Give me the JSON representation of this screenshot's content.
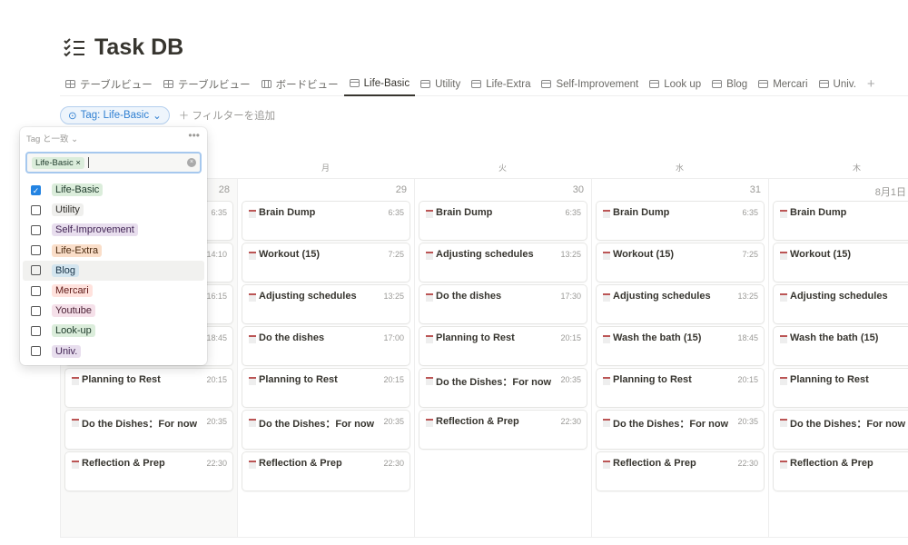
{
  "page": {
    "title": "Task DB",
    "icon": "checklist-icon"
  },
  "tabs": [
    {
      "label": "テーブルビュー",
      "icon": "table-icon"
    },
    {
      "label": "テーブルビュー",
      "icon": "table-icon"
    },
    {
      "label": "ボードビュー",
      "icon": "board-icon"
    },
    {
      "label": "Life-Basic",
      "icon": "calendar-icon",
      "active": true
    },
    {
      "label": "Utility",
      "icon": "calendar-icon"
    },
    {
      "label": "Life-Extra",
      "icon": "calendar-icon"
    },
    {
      "label": "Self-Improvement",
      "icon": "calendar-icon"
    },
    {
      "label": "Look up",
      "icon": "calendar-icon"
    },
    {
      "label": "Blog",
      "icon": "calendar-icon"
    },
    {
      "label": "Mercari",
      "icon": "calendar-icon"
    },
    {
      "label": "Univ.",
      "icon": "calendar-icon"
    }
  ],
  "add_tab": "+",
  "filter": {
    "chip": "Tag: Life-Basic",
    "add": "＋ フィルターを追加"
  },
  "popup": {
    "header": "Tag と一致 ⌄",
    "more": "•••",
    "selected_tag": "Life-Basic",
    "remove": "×",
    "options": [
      {
        "label": "Life-Basic",
        "checked": true,
        "bg": "#dbeddb",
        "fg": "#1c3829"
      },
      {
        "label": "Utility",
        "checked": false,
        "bg": "#efefed",
        "fg": "#32302c"
      },
      {
        "label": "Self-Improvement",
        "checked": false,
        "bg": "#e8deee",
        "fg": "#412454"
      },
      {
        "label": "Life-Extra",
        "checked": false,
        "bg": "#fadec9",
        "fg": "#49290e"
      },
      {
        "label": "Blog",
        "checked": false,
        "bg": "#d3e5ef",
        "fg": "#183347"
      },
      {
        "label": "Mercari",
        "checked": false,
        "bg": "#ffe2dd",
        "fg": "#5d1715"
      },
      {
        "label": "Youtube",
        "checked": false,
        "bg": "#f5e0e9",
        "fg": "#4c2337"
      },
      {
        "label": "Look-up",
        "checked": false,
        "bg": "#dbeddb",
        "fg": "#1c3829"
      },
      {
        "label": "Univ.",
        "checked": false,
        "bg": "#e8deee",
        "fg": "#412454"
      }
    ]
  },
  "calendar": {
    "days": [
      {
        "dow": "",
        "date": "28",
        "sun": true,
        "events": [
          [
            "",
            "6:35"
          ],
          [
            "",
            "14:10"
          ],
          [
            "",
            "16:15"
          ],
          [
            "",
            "18:45"
          ],
          [
            "Planning to Rest",
            "20:15"
          ],
          [
            "Do the Dishes：For now",
            "20:35"
          ],
          [
            "Reflection & Prep",
            "22:30"
          ]
        ]
      },
      {
        "dow": "月",
        "date": "29",
        "events": [
          [
            "Brain Dump",
            "6:35"
          ],
          [
            "Workout (15)",
            "7:25"
          ],
          [
            "Adjusting schedules",
            "13:25"
          ],
          [
            "Do the dishes",
            "17:00"
          ],
          [
            "Planning to Rest",
            "20:15"
          ],
          [
            "Do the Dishes：For now",
            "20:35"
          ],
          [
            "Reflection & Prep",
            "22:30"
          ]
        ]
      },
      {
        "dow": "火",
        "date": "30",
        "events": [
          [
            "Brain Dump",
            "6:35"
          ],
          [
            "Adjusting schedules",
            "13:25"
          ],
          [
            "Do the dishes",
            "17:30"
          ],
          [
            "Planning to Rest",
            "20:15"
          ],
          [
            "Do the Dishes：For now",
            "20:35"
          ],
          [
            "Reflection & Prep",
            "22:30"
          ]
        ]
      },
      {
        "dow": "水",
        "date": "31",
        "events": [
          [
            "Brain Dump",
            "6:35"
          ],
          [
            "Workout (15)",
            "7:25"
          ],
          [
            "Adjusting schedules",
            "13:25"
          ],
          [
            "Wash the bath (15)",
            "18:45"
          ],
          [
            "Planning to Rest",
            "20:15"
          ],
          [
            "Do the Dishes：For now",
            "20:35"
          ],
          [
            "Reflection & Prep",
            "22:30"
          ]
        ]
      },
      {
        "dow": "木",
        "date": "8月1日",
        "events": [
          [
            "Brain Dump",
            ""
          ],
          [
            "Workout (15)",
            ""
          ],
          [
            "Adjusting schedules",
            ""
          ],
          [
            "Wash the bath (15)",
            ""
          ],
          [
            "Planning to Rest",
            ""
          ],
          [
            "Do the Dishes：For now",
            ""
          ],
          [
            "Reflection & Prep",
            ""
          ]
        ]
      }
    ]
  }
}
